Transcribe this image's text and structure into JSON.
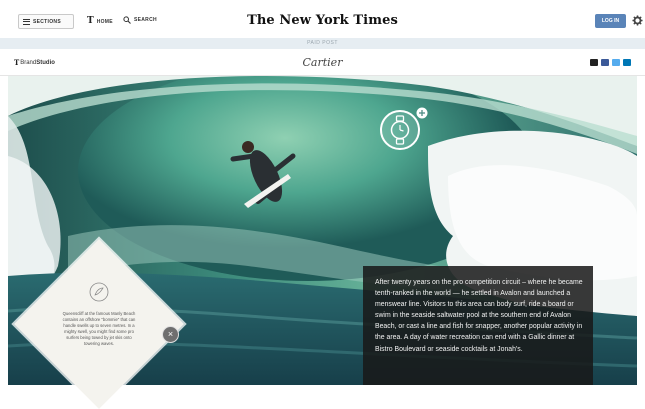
{
  "header": {
    "sections_label": "SECTIONS",
    "home_label": "HOME",
    "search_label": "SEARCH",
    "masthead": "The New York Times",
    "login_label": "LOG IN"
  },
  "paid_post_label": "PAID POST",
  "brand_bar": {
    "t_logo": "T",
    "brand_studio_prefix": "Brand",
    "brand_studio_bold": "Studio",
    "sponsor": "Cartier",
    "social": [
      {
        "name": "mail-icon",
        "color": "#222222"
      },
      {
        "name": "facebook-icon",
        "color": "#3b5998"
      },
      {
        "name": "twitter-icon",
        "color": "#55acee"
      },
      {
        "name": "linkedin-icon",
        "color": "#0077b5"
      }
    ]
  },
  "caption": {
    "text": "After twenty years on the pro competition circuit – where he became tenth-ranked in the world — he settled in Avalon and launched a menswear line. Visitors to this area can body surf, ride a board or swim in the seaside saltwater pool at the southern end of Avalon Beach, or cast a line and fish for snapper, another popular activity in the area. A day of water recreation can end with a Gallic dinner at Bistro Boulevard or seaside cocktails at Jonah's."
  },
  "callout": {
    "text": "Queenscliff at the famous Manly Beach contains an offshore \"bommie\" that can handle swells up to seven metres. In a mighty swell, you might find some pro surfers being towed by jet skis onto towering waves.",
    "close_label": "×"
  },
  "colors": {
    "login": "#5a84b8",
    "paid_bar": "#e6edf2",
    "caption_bg": "#191919"
  }
}
